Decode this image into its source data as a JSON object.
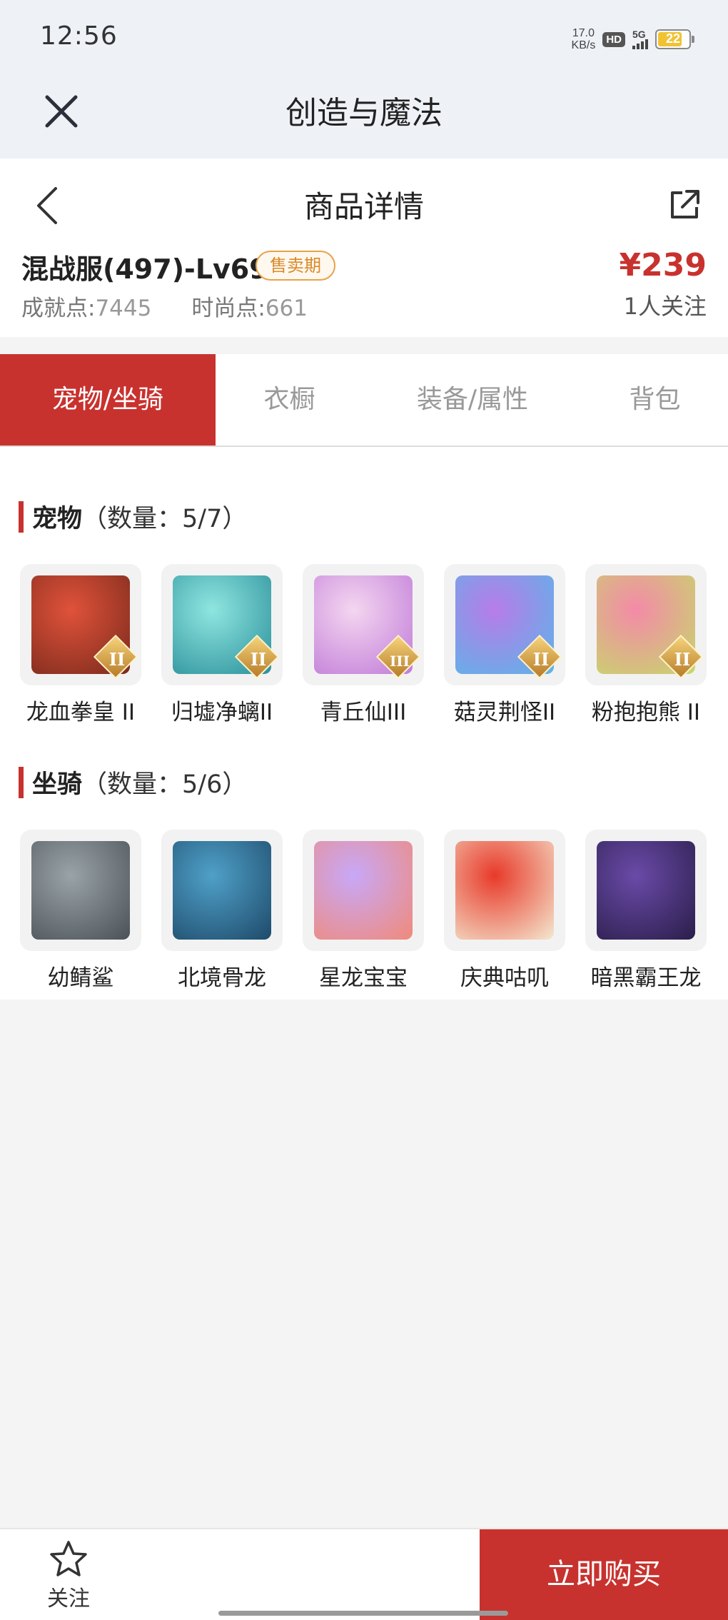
{
  "status_bar": {
    "time": "12:56",
    "net_speed_value": "17.0",
    "net_speed_unit": "KB/s",
    "hd_label": "HD",
    "network_label": "5G",
    "battery_level": "22"
  },
  "app": {
    "title": "创造与魔法",
    "close_icon": "close-icon"
  },
  "detail": {
    "title": "商品详情",
    "back_icon": "chevron-left-icon",
    "share_icon": "share-icon"
  },
  "goods": {
    "server_name": "混战服(497)-Lv69",
    "sale_status": "售卖期",
    "price": "¥239",
    "achievement_label": "成就点:",
    "achievement_value": "7445",
    "fashion_label": "时尚点:",
    "fashion_value": "661",
    "followers": "1人关注"
  },
  "tabs": [
    {
      "label": "宠物/坐骑",
      "active": true
    },
    {
      "label": "衣橱",
      "active": false
    },
    {
      "label": "装备/属性",
      "active": false
    },
    {
      "label": "背包",
      "active": false
    }
  ],
  "pets": {
    "title": "宠物",
    "count": "（数量：5/7）",
    "items": [
      {
        "name": "龙血拳皇 II",
        "tier": "II",
        "colors": [
          "#e0523a",
          "#7a2a1c"
        ]
      },
      {
        "name": "归墟净螭II",
        "tier": "II",
        "colors": [
          "#8fe6e0",
          "#2a8f9a"
        ]
      },
      {
        "name": "青丘仙III",
        "tier": "III",
        "colors": [
          "#f4d6f0",
          "#c07ad8"
        ]
      },
      {
        "name": "菇灵荆怪II",
        "tier": "II",
        "colors": [
          "#b77ce8",
          "#5ab6e8"
        ]
      },
      {
        "name": "粉抱抱熊 II",
        "tier": "II",
        "colors": [
          "#f48aa8",
          "#c6d86a"
        ]
      }
    ]
  },
  "mounts": {
    "title": "坐骑",
    "count": "（数量：5/6）",
    "items": [
      {
        "name": "幼鲭鲨",
        "colors": [
          "#9aa3a8",
          "#4a5258"
        ]
      },
      {
        "name": "北境骨龙",
        "colors": [
          "#4fa0c8",
          "#1e4a6a"
        ]
      },
      {
        "name": "星龙宝宝",
        "colors": [
          "#c8a8f8",
          "#f08a7a"
        ]
      },
      {
        "name": "庆典咕叽",
        "colors": [
          "#e83a2a",
          "#f4e8d0"
        ]
      },
      {
        "name": "暗黑霸王龙",
        "colors": [
          "#6a4aa8",
          "#2a1e4a"
        ]
      }
    ]
  },
  "bottom_bar": {
    "follow_label": "关注",
    "follow_icon": "star-icon",
    "buy_label": "立即购买"
  },
  "colors": {
    "accent": "#c8322e",
    "sale_badge": "#d98a2b"
  }
}
